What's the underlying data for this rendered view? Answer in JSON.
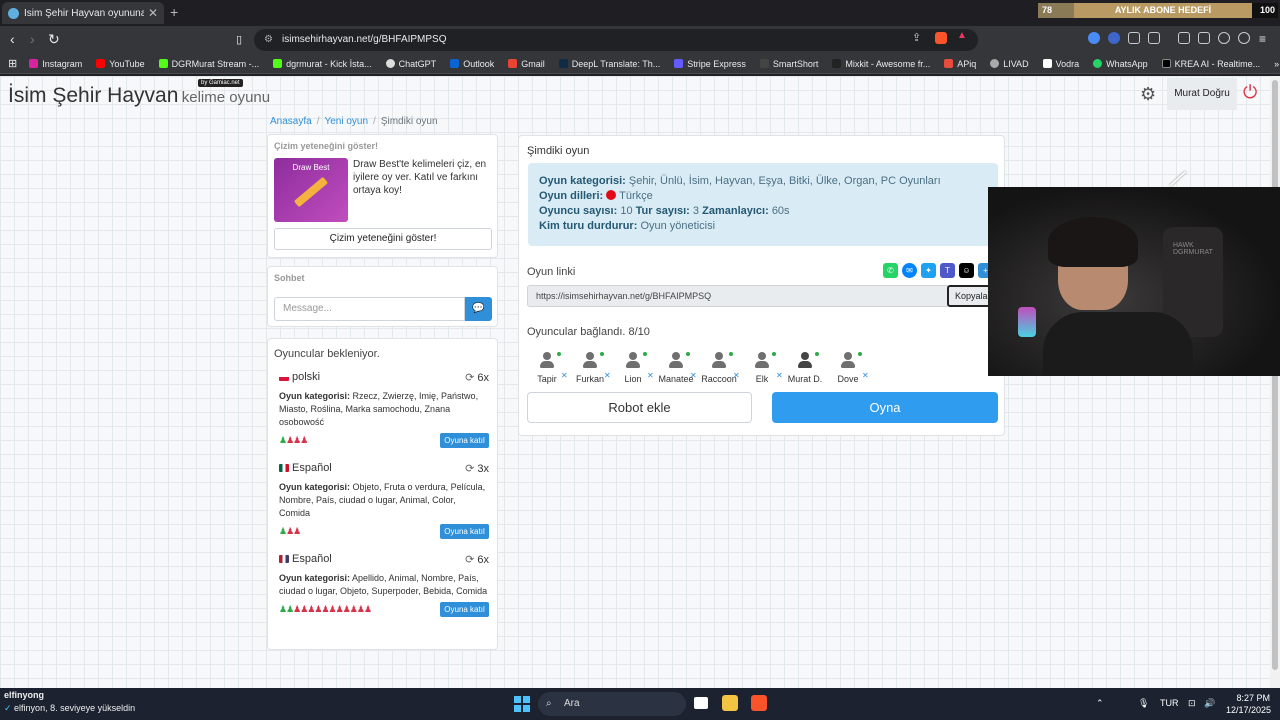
{
  "browser": {
    "tab_title": "İsim Şehir Hayvan oyununa katıl",
    "url": "isimsehirhayvan.net/g/BHFAIPMPSQ",
    "goal": {
      "left": "78",
      "label": "AYLIK ABONE HEDEFİ",
      "right": "100"
    },
    "bookmarks": [
      "Instagram",
      "YouTube",
      "DGRMurat Stream -...",
      "dgrmurat - Kick İsta...",
      "ChatGPT",
      "Outlook",
      "Gmail",
      "DeepL Translate: Th...",
      "Stripe Express",
      "SmartShort",
      "Mixkit - Awesome fr...",
      "APiq",
      "LIVAD",
      "Vodra",
      "WhatsApp",
      "KREA AI - Realtime..."
    ]
  },
  "header": {
    "logo_main": "İsim Şehir Hayvan",
    "logo_sub": "kelime oyunu",
    "logo_by": "by Gamiac.net",
    "user": "Murat Doğru"
  },
  "breadcrumb": {
    "home": "Anasayfa",
    "new": "Yeni oyun",
    "current": "Şimdiki oyun"
  },
  "promo": {
    "title": "Çizim yeteneğini göster!",
    "img_text": "Draw Best",
    "text": "Draw Best'te kelimeleri çiz, en iyilere oy ver. Katıl ve farkını ortaya koy!",
    "button": "Çizim yeteneğini göster!"
  },
  "chat": {
    "title": "Sohbet",
    "placeholder": "Message..."
  },
  "waiting": {
    "title": "Oyuncular bekleniyor.",
    "cat_label": "Oyun kategorisi:",
    "join_label": "Oyuna katıl",
    "games": [
      {
        "lang": "polski",
        "rounds": "6x",
        "flag_colors": [
          "#ffffff",
          "#dc143c"
        ],
        "cats": "Rzecz, Zwierzę, Imię, Państwo, Miasto, Roślina, Marka samochodu, Znana osobowość",
        "joined": 1,
        "open": 3
      },
      {
        "lang": "Español",
        "rounds": "3x",
        "flag_colors": [
          "#006847",
          "#ffffff",
          "#ce1126"
        ],
        "cats": "Objeto, Fruta o verdura, Película, Nombre, País, ciudad o lugar, Animal, Color, Comida",
        "joined": 1,
        "open": 2
      },
      {
        "lang": "Español",
        "rounds": "6x",
        "flag_colors": [
          "#b22234",
          "#ffffff",
          "#3c3b6e"
        ],
        "cats": "Apellido, Animal, Nombre, País, ciudad o lugar, Objeto, Superpoder, Bebida, Comida",
        "joined": 2,
        "open": 11
      }
    ]
  },
  "current": {
    "title": "Şimdiki oyun",
    "categories_label": "Oyun kategorisi:",
    "categories": "Şehir, Ünlü, İsim, Hayvan, Eşya, Bitki, Ülke, Organ, PC Oyunları",
    "langs_label": "Oyun dilleri:",
    "langs": "Türkçe",
    "players_label": "Oyuncu sayısı:",
    "players": "10",
    "rounds_label": "Tur sayısı:",
    "rounds": "3",
    "timer_label": "Zamanlayıcı:",
    "timer": "60s",
    "stopper_label": "Kim turu durdurur:",
    "stopper": "Oyun yöneticisi",
    "link_title": "Oyun linki",
    "link": "https://isimsehirhayvan.net/g/BHFAIPMPSQ",
    "copy": "Kopyala",
    "connected": "Oyuncular bağlandı. 8/10",
    "players_list": [
      "Tapir",
      "Furkan",
      "Lion",
      "Manatee",
      "Raccoon",
      "Elk",
      "Murat D.",
      "Dove"
    ],
    "robot": "Robot ekle",
    "play": "Oyna"
  },
  "webcam": {
    "chair_text": "HAWK",
    "chair_sub": "DGRMURAT"
  },
  "taskbar": {
    "user": "elfinyong",
    "notif": "elfinyon, 8. seviyeye yükseldin",
    "search": "Ara",
    "lang": "TUR",
    "time": "8:27 PM",
    "date": "12/17/2025"
  },
  "colors": {
    "accent": "#2f9cf0",
    "link": "#2f8fd8",
    "info_bg": "#d9ecf5",
    "danger": "#d9334a",
    "success": "#2eaa4a"
  }
}
